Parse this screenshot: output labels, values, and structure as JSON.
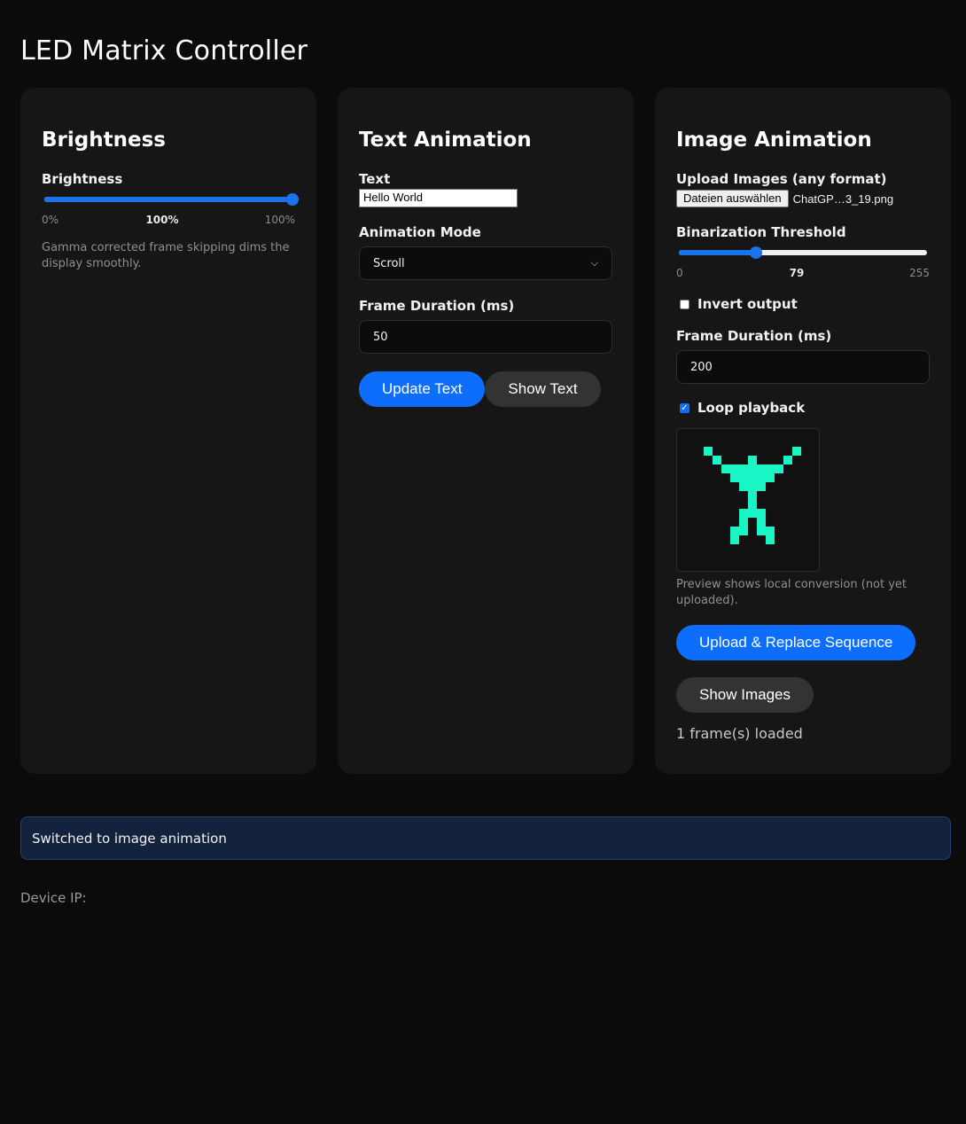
{
  "page_title": "LED Matrix Controller",
  "brightness": {
    "heading": "Brightness",
    "label": "Brightness",
    "value_label": "100%",
    "min_label": "0%",
    "max_label": "100%",
    "value_fraction": 1.0,
    "hint": "Gamma corrected frame skipping dims the display smoothly."
  },
  "text_animation": {
    "heading": "Text Animation",
    "text_label": "Text",
    "text_value": "Hello World",
    "mode_label": "Animation Mode",
    "mode_value": "Scroll",
    "duration_label": "Frame Duration (ms)",
    "duration_value": "50",
    "update_button": "Update Text",
    "show_button": "Show Text"
  },
  "image_animation": {
    "heading": "Image Animation",
    "upload_label": "Upload Images (any format)",
    "file_button": "Dateien auswählen",
    "file_name": "ChatGP…3_19.png",
    "threshold_label": "Binarization Threshold",
    "threshold_min": "0",
    "threshold_value": "79",
    "threshold_max": "255",
    "threshold_fraction": 0.31,
    "invert_label": "Invert output",
    "invert_checked": false,
    "duration_label": "Frame Duration (ms)",
    "duration_value": "200",
    "loop_label": "Loop playback",
    "loop_checked": true,
    "preview_caption": "Preview shows local conversion (not yet uploaded).",
    "upload_button": "Upload & Replace Sequence",
    "show_button": "Show Images",
    "frames_status": "1 frame(s) loaded",
    "pixel_color": "#19f5c4"
  },
  "status_message": "Switched to image animation",
  "device_ip_label": "Device IP:",
  "colors": {
    "accent": "#0d6efd",
    "background": "#0b0b0b",
    "card": "#161616",
    "status_bg": "#13233d"
  }
}
